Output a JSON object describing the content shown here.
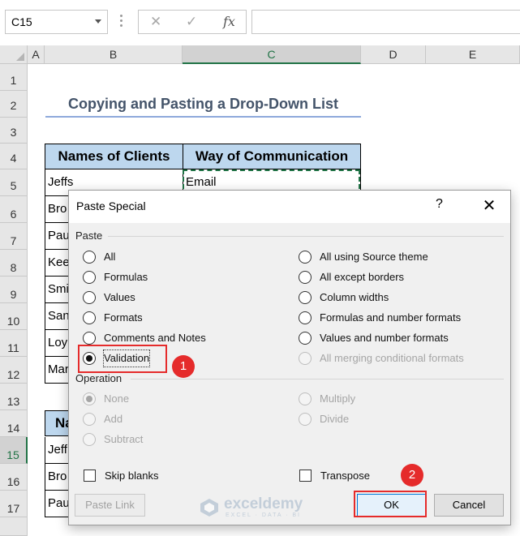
{
  "formula_bar": {
    "name_box": "C15",
    "cancel_icon": "✕",
    "enter_icon": "✓",
    "fx_label": "fx",
    "formula": ""
  },
  "columns": [
    "A",
    "B",
    "C",
    "D",
    "E"
  ],
  "selected_column": "C",
  "rows": [
    "1",
    "2",
    "3",
    "4",
    "5",
    "6",
    "7",
    "8",
    "9",
    "10",
    "11",
    "12",
    "13",
    "14",
    "15",
    "16",
    "17"
  ],
  "selected_row": "15",
  "sheet": {
    "title": "Copying and Pasting a Drop-Down List",
    "table1": {
      "headers": [
        "Names of Clients",
        "Way of Communication"
      ],
      "rows": [
        [
          "Jeffs",
          "Email"
        ],
        [
          "Bro",
          ""
        ],
        [
          "Pau",
          ""
        ],
        [
          "Kee",
          ""
        ],
        [
          "Smi",
          ""
        ],
        [
          "San",
          ""
        ],
        [
          "Loy",
          ""
        ],
        [
          "Mar",
          ""
        ]
      ]
    },
    "table2": {
      "header_fragment": "Na",
      "rows": [
        "Jeff",
        "Bro",
        "Pau"
      ]
    }
  },
  "dialog": {
    "title": "Paste Special",
    "help_icon": "?",
    "close_icon": "✕",
    "paste_group": "Paste",
    "paste_options_left": [
      {
        "label": "All",
        "selected": false
      },
      {
        "label": "Formulas",
        "selected": false
      },
      {
        "label": "Values",
        "selected": false
      },
      {
        "label": "Formats",
        "selected": false
      },
      {
        "label": "Comments and Notes",
        "selected": false
      },
      {
        "label": "Validation",
        "selected": true
      }
    ],
    "paste_options_right": [
      {
        "label": "All using Source theme",
        "enabled": true
      },
      {
        "label": "All except borders",
        "enabled": true
      },
      {
        "label": "Column widths",
        "enabled": true
      },
      {
        "label": "Formulas and number formats",
        "enabled": true
      },
      {
        "label": "Values and number formats",
        "enabled": true
      },
      {
        "label": "All merging conditional formats",
        "enabled": false
      }
    ],
    "operation_group": "Operation",
    "operation_left": [
      "None",
      "Add",
      "Subtract"
    ],
    "operation_right": [
      "Multiply",
      "Divide"
    ],
    "operation_selected": "None",
    "skip_blanks_label": "Skip blanks",
    "transpose_label": "Transpose",
    "paste_link_label": "Paste Link",
    "ok_label": "OK",
    "cancel_label": "Cancel"
  },
  "annotations": {
    "step1": "1",
    "step2": "2"
  },
  "watermark": {
    "name": "exceldemy",
    "tagline": "EXCEL · DATA · BI"
  },
  "colors": {
    "header_fill": "#bdd7ee",
    "title_color": "#44546a",
    "excel_green": "#217346",
    "annotation_red": "#e52b2b",
    "ok_border": "#0078d7"
  }
}
